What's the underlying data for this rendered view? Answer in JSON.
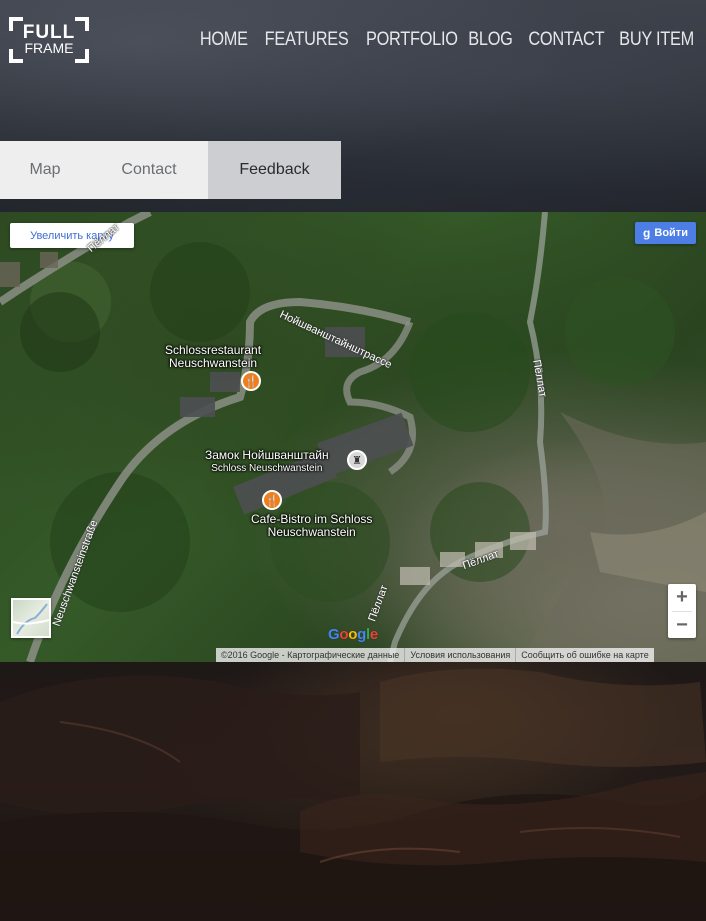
{
  "logo": {
    "line1": "FULL",
    "line2": "FRAME"
  },
  "nav": [
    {
      "label": "HOME"
    },
    {
      "label": "FEATURES"
    },
    {
      "label": "PORTFOLIO"
    },
    {
      "label": "BLOG"
    },
    {
      "label": "CONTACT"
    },
    {
      "label": "BUY ITEM"
    }
  ],
  "tabs": [
    {
      "label": "Map",
      "active": false
    },
    {
      "label": "Contact",
      "active": false
    },
    {
      "label": "Feedback",
      "active": true
    }
  ],
  "map": {
    "enlarge_label": "Увеличить карту",
    "signin_label": "Войти",
    "signin_icon": "g",
    "labels": {
      "restaurant_line1": "Schlossrestaurant",
      "restaurant_line2": "Neuschwanstein",
      "castle_line1": "Замок Нойшванштайн",
      "castle_line2": "Schloss Neuschwanstein",
      "cafe_line1": "Cafe-Bistro im Schloss",
      "cafe_line2": "Neuschwanstein",
      "road_top": "Нойшванштайнштрассе",
      "road_left": "Neuschwansteinstraße",
      "road_topleft": "Пёллат",
      "river_right": "Пёллат",
      "river_mid": "Пёллат",
      "river_bottom": "Пёллат"
    },
    "zoom_in": "+",
    "zoom_out": "−",
    "google_logo": "Google",
    "attribution": [
      "©2016 Google - Картографические данные",
      "Условия использования",
      "Сообщить об ошибке на карте"
    ]
  },
  "colors": {
    "active_tab": "#cdced1",
    "inactive_tab": "#eeeeee",
    "signin_button": "#4d7ee5",
    "poi_pin": "#f07e1a"
  }
}
